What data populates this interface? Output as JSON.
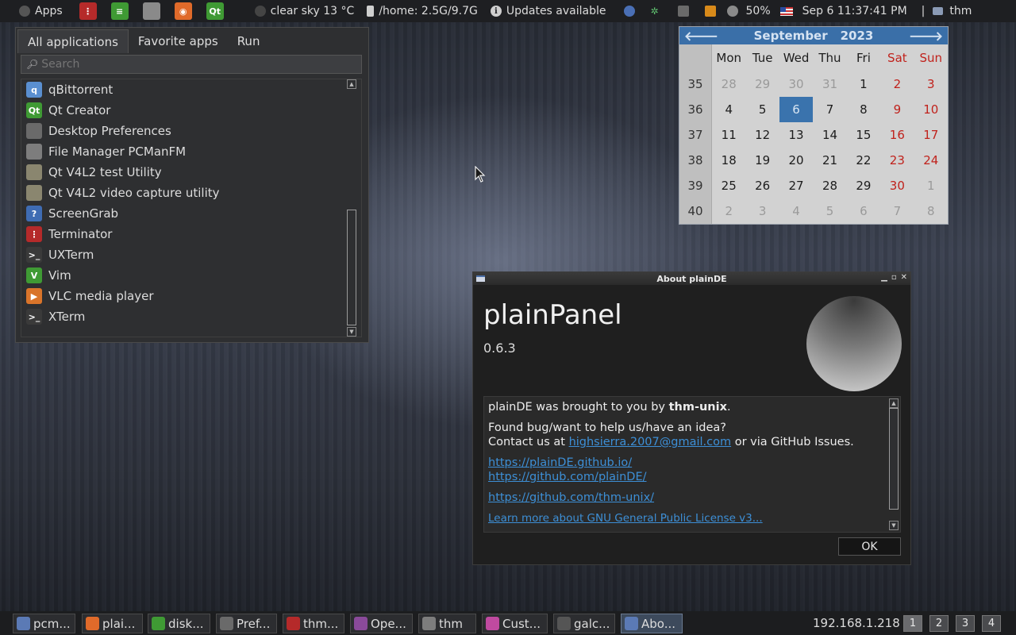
{
  "top_panel": {
    "apps_label": "Apps",
    "weather": "clear sky 13 °C",
    "disk": "/home: 2.5G/9.7G",
    "updates": "Updates available",
    "volume": "50%",
    "datetime": "Sep 6 11:37:41 PM",
    "separator": "|",
    "user": "thm",
    "launchers": [
      {
        "name": "Terminator",
        "glyph": "⋮",
        "color": "#b52a2a"
      },
      {
        "name": "Text Editor",
        "glyph": "≡",
        "color": "#3f9a34"
      },
      {
        "name": "File Manager",
        "glyph": "",
        "color": "#8a8a8a"
      },
      {
        "name": "Firefox",
        "glyph": "◉",
        "color": "#e06a2a"
      },
      {
        "name": "Qt Creator",
        "glyph": "Qt",
        "color": "#3f9a34"
      }
    ]
  },
  "app_menu": {
    "tabs": [
      "All applications",
      "Favorite apps",
      "Run"
    ],
    "search_placeholder": "Search",
    "items": [
      {
        "label": "qBittorrent",
        "icon": "qbittorrent-icon",
        "glyph": "q",
        "color": "#5a8fd0"
      },
      {
        "label": "Qt Creator",
        "icon": "qt-icon",
        "glyph": "Qt",
        "color": "#3f9a34"
      },
      {
        "label": "Desktop Preferences",
        "icon": "preferences-icon",
        "glyph": "",
        "color": "#6a6a6a"
      },
      {
        "label": "File Manager PCManFM",
        "icon": "folder-icon",
        "glyph": "",
        "color": "#7d7d7d"
      },
      {
        "label": "Qt V4L2 test Utility",
        "icon": "camera-icon",
        "glyph": "",
        "color": "#8a866f"
      },
      {
        "label": "Qt V4L2 video capture utility",
        "icon": "video-capture-icon",
        "glyph": "",
        "color": "#8a866f"
      },
      {
        "label": "ScreenGrab",
        "icon": "help-icon",
        "glyph": "?",
        "color": "#3f6cb3"
      },
      {
        "label": "Terminator",
        "icon": "terminator-icon",
        "glyph": "⋮",
        "color": "#b52a2a"
      },
      {
        "label": "UXTerm",
        "icon": "terminal-icon",
        "glyph": ">_",
        "color": "#3a3a3a"
      },
      {
        "label": "Vim",
        "icon": "vim-icon",
        "glyph": "V",
        "color": "#3f9a34"
      },
      {
        "label": "VLC media player",
        "icon": "vlc-icon",
        "glyph": "▶",
        "color": "#d9742a"
      },
      {
        "label": "XTerm",
        "icon": "terminal-icon",
        "glyph": ">_",
        "color": "#3a3a3a"
      }
    ]
  },
  "calendar": {
    "month": "September",
    "year": "2023",
    "days_of_week": [
      "Mon",
      "Tue",
      "Wed",
      "Thu",
      "Fri",
      "Sat",
      "Sun"
    ],
    "weeks": [
      {
        "week": "35",
        "days": [
          "28",
          "29",
          "30",
          "31",
          "1",
          "2",
          "3"
        ],
        "other": [
          true,
          true,
          true,
          true,
          false,
          false,
          false
        ]
      },
      {
        "week": "36",
        "days": [
          "4",
          "5",
          "6",
          "7",
          "8",
          "9",
          "10"
        ],
        "other": [
          false,
          false,
          false,
          false,
          false,
          false,
          false
        ]
      },
      {
        "week": "37",
        "days": [
          "11",
          "12",
          "13",
          "14",
          "15",
          "16",
          "17"
        ],
        "other": [
          false,
          false,
          false,
          false,
          false,
          false,
          false
        ]
      },
      {
        "week": "38",
        "days": [
          "18",
          "19",
          "20",
          "21",
          "22",
          "23",
          "24"
        ],
        "other": [
          false,
          false,
          false,
          false,
          false,
          false,
          false
        ]
      },
      {
        "week": "39",
        "days": [
          "25",
          "26",
          "27",
          "28",
          "29",
          "30",
          "1"
        ],
        "other": [
          false,
          false,
          false,
          false,
          false,
          false,
          true
        ]
      },
      {
        "week": "40",
        "days": [
          "2",
          "3",
          "4",
          "5",
          "6",
          "7",
          "8"
        ],
        "other": [
          true,
          true,
          true,
          true,
          true,
          true,
          true
        ]
      }
    ],
    "today": "6"
  },
  "about_dialog": {
    "title": "About plainDE",
    "app_name": "plainPanel",
    "version": "0.6.3",
    "intro_prefix": "plainDE was brought to you by ",
    "author": "thm-unix",
    "intro_suffix": ".",
    "bug_line": "Found bug/want to help us/have an idea?",
    "contact_prefix": "Contact us at ",
    "email": "highsierra.2007@gmail.com",
    "contact_suffix": " or via GitHub Issues.",
    "link_site": "https://plainDE.github.io/",
    "link_org": "https://github.com/plainDE/",
    "link_author": "https://github.com/thm-unix/",
    "license_link": "Learn more about GNU General Public License v3...",
    "ok_label": "OK"
  },
  "taskbar": {
    "tasks": [
      {
        "label": "pcm...",
        "color": "#5b7ab5",
        "active": false
      },
      {
        "label": "plai...",
        "color": "#e06a2a",
        "active": false
      },
      {
        "label": "disk...",
        "color": "#3f9a34",
        "active": false
      },
      {
        "label": "Pref...",
        "color": "#6a6a6a",
        "active": false
      },
      {
        "label": "thm...",
        "color": "#b52a2a",
        "active": false
      },
      {
        "label": "Ope...",
        "color": "#8a4a9a",
        "active": false
      },
      {
        "label": "thm",
        "color": "#7d7d7d",
        "active": false
      },
      {
        "label": "Cust...",
        "color": "#c04aa0",
        "active": false
      },
      {
        "label": "galc...",
        "color": "#555555",
        "active": false
      },
      {
        "label": "Abo...",
        "color": "#5b7ab5",
        "active": true
      }
    ],
    "ip": "192.168.1.218",
    "workspaces": [
      "1",
      "2",
      "3",
      "4"
    ],
    "active_workspace": "1"
  }
}
